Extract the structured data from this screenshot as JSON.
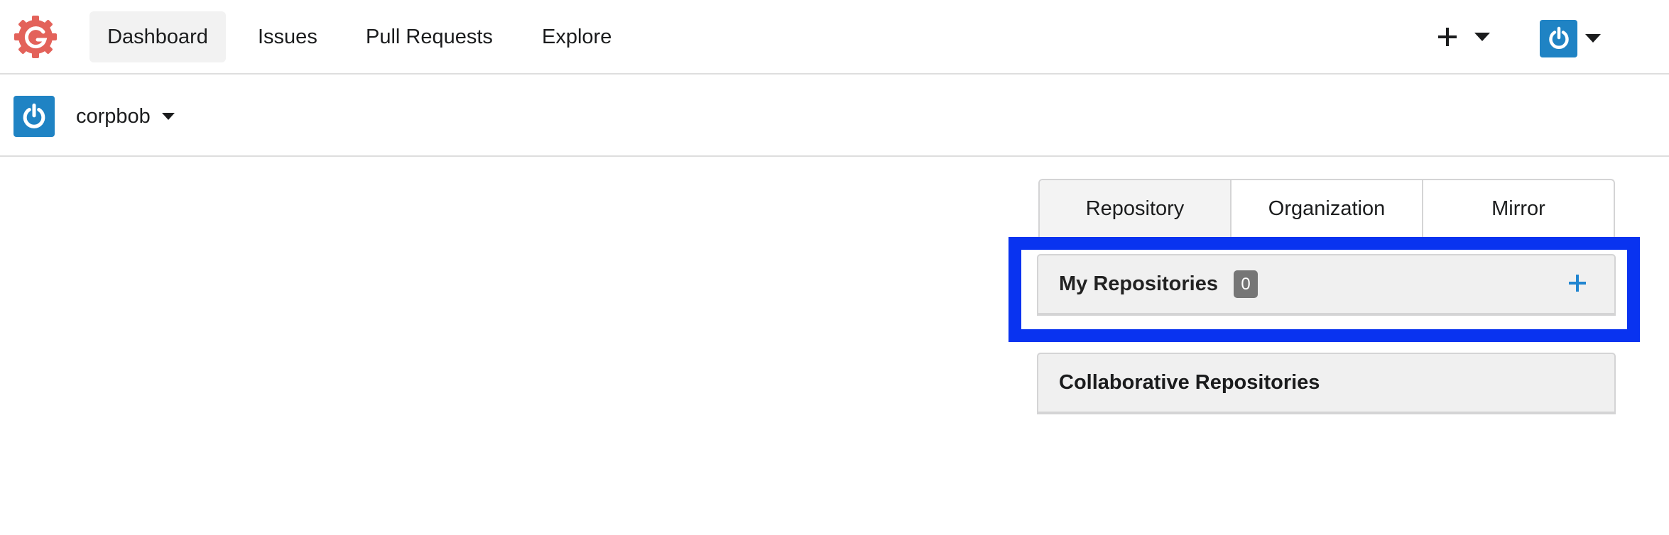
{
  "nav": {
    "logo_icon": "gogs-logo",
    "items": [
      {
        "label": "Dashboard",
        "active": true
      },
      {
        "label": "Issues"
      },
      {
        "label": "Pull Requests"
      },
      {
        "label": "Explore"
      }
    ],
    "create_menu_icon": "plus-icon",
    "user_avatar_icon": "power-avatar"
  },
  "context": {
    "user": "corpbob"
  },
  "tabs": [
    {
      "label": "Repository",
      "active": true
    },
    {
      "label": "Organization"
    },
    {
      "label": "Mirror"
    }
  ],
  "my_repos": {
    "title": "My Repositories",
    "count": "0"
  },
  "collab_repos": {
    "title": "Collaborative Repositories"
  },
  "colors": {
    "avatar": "#1f83c4",
    "logo": "#e3625a",
    "highlight": "#0933f0",
    "accent": "#2185d0"
  }
}
